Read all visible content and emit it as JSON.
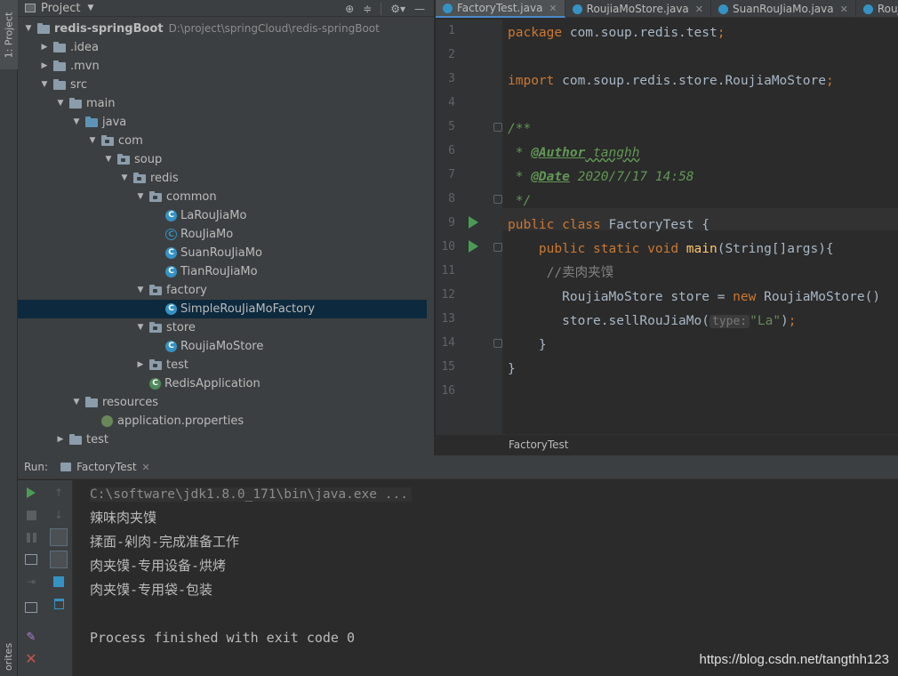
{
  "left_strip": {
    "project_tab": "1: Project",
    "favorites_tab": "orites"
  },
  "project_panel": {
    "title": "Project",
    "tree": [
      {
        "label": "redis-springBoot",
        "path": "D:\\project\\springCloud\\redis-springBoot",
        "depth": 0,
        "expanded": true,
        "icon": "module-folder-icon",
        "bold": true
      },
      {
        "label": ".idea",
        "depth": 1,
        "expanded": false,
        "icon": "folder-icon"
      },
      {
        "label": ".mvn",
        "depth": 1,
        "expanded": false,
        "icon": "folder-icon"
      },
      {
        "label": "src",
        "depth": 1,
        "expanded": true,
        "icon": "folder-icon"
      },
      {
        "label": "main",
        "depth": 2,
        "expanded": true,
        "icon": "folder-icon"
      },
      {
        "label": "java",
        "depth": 3,
        "expanded": true,
        "icon": "source-folder-icon"
      },
      {
        "label": "com",
        "depth": 4,
        "expanded": true,
        "icon": "package-icon"
      },
      {
        "label": "soup",
        "depth": 5,
        "expanded": true,
        "icon": "package-icon"
      },
      {
        "label": "redis",
        "depth": 6,
        "expanded": true,
        "icon": "package-icon"
      },
      {
        "label": "common",
        "depth": 7,
        "expanded": true,
        "icon": "package-icon"
      },
      {
        "label": "LaRouJiaMo",
        "depth": 8,
        "icon": "class-icon"
      },
      {
        "label": "RouJiaMo",
        "depth": 8,
        "icon": "abstract-class-icon"
      },
      {
        "label": "SuanRouJiaMo",
        "depth": 8,
        "icon": "class-icon"
      },
      {
        "label": "TianRouJiaMo",
        "depth": 8,
        "icon": "class-icon"
      },
      {
        "label": "factory",
        "depth": 7,
        "expanded": true,
        "icon": "package-icon"
      },
      {
        "label": "SimpleRouJiaMoFactory",
        "depth": 8,
        "icon": "class-icon",
        "selected": true
      },
      {
        "label": "store",
        "depth": 7,
        "expanded": true,
        "icon": "package-icon"
      },
      {
        "label": "RoujiaMoStore",
        "depth": 8,
        "icon": "class-icon"
      },
      {
        "label": "test",
        "depth": 7,
        "expanded": false,
        "icon": "package-icon"
      },
      {
        "label": "RedisApplication",
        "depth": 7,
        "icon": "spring-class-icon"
      },
      {
        "label": "resources",
        "depth": 3,
        "expanded": true,
        "icon": "resources-folder-icon"
      },
      {
        "label": "application.properties",
        "depth": 4,
        "icon": "spring-properties-icon"
      },
      {
        "label": "test",
        "depth": 2,
        "expanded": false,
        "icon": "folder-icon"
      }
    ]
  },
  "editor": {
    "tabs": [
      {
        "label": "FactoryTest.java",
        "active": true
      },
      {
        "label": "RoujiaMoStore.java",
        "active": false
      },
      {
        "label": "SuanRouJiaMo.java",
        "active": false
      },
      {
        "label": "RouJ",
        "active": false
      }
    ],
    "line_numbers": [
      "1",
      "2",
      "3",
      "4",
      "5",
      "6",
      "7",
      "8",
      "9",
      "10",
      "11",
      "12",
      "13",
      "14",
      "15",
      "16"
    ],
    "code": {
      "l1_kw": "package",
      "l1_rest": " com.soup.redis.test",
      "l1_semi": ";",
      "l3_kw": "import",
      "l3_rest": " com.soup.redis.store.RoujiaMoStore",
      "l3_semi": ";",
      "l5": "/**",
      "l6_star": " * ",
      "l6_tag": "@Author",
      "l6_val": " tanghh",
      "l7_star": " * ",
      "l7_tag": "@Date",
      "l7_val": " 2020/7/17 14:58",
      "l8": " */",
      "l9_kw": "public class",
      "l9_rest": " FactoryTest {",
      "l10_indent": "    ",
      "l10_kw": "public static void",
      "l10_sp": " ",
      "l10_fn": "main",
      "l10_rest": "(String[]args){",
      "l11": "     //卖肉夹馍",
      "l12_a": "       RoujiaMoStore store = ",
      "l12_kw": "new",
      "l12_b": " RoujiaMoStore()",
      "l13_a": "       store.sellRouJiaMo(",
      "l13_hint": "type:",
      "l13_str": "\"La\"",
      "l13_b": ")",
      "l13_semi": ";",
      "l14": "    }",
      "l15": "}"
    },
    "breadcrumb": "FactoryTest"
  },
  "run_panel": {
    "label": "Run:",
    "tab": "FactoryTest",
    "console": [
      "C:\\software\\jdk1.8.0_171\\bin\\java.exe ...",
      "辣味肉夹馍",
      "揉面-剁肉-完成准备工作",
      "肉夹馍-专用设备-烘烤",
      "肉夹馍-专用袋-包装",
      "",
      "Process finished with exit code 0"
    ],
    "watermark": "https://blog.csdn.net/tangthh123"
  },
  "colors": {
    "background": "#2b2b2b",
    "panel": "#3c3f41",
    "keyword": "#cc7832",
    "doc_comment": "#629755",
    "string": "#6a8759",
    "function": "#ffc66d",
    "selection": "#0d293e",
    "run_green": "#499c54"
  }
}
